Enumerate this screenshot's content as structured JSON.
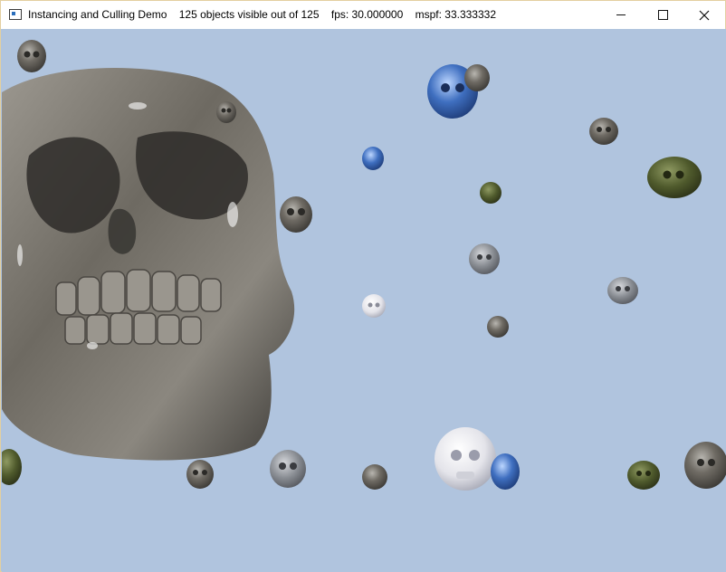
{
  "window": {
    "app": "Instancing and Culling Demo",
    "stats": "125 objects visible out of 125",
    "fps": "fps: 30.000000",
    "mspf": "mspf: 33.333332",
    "title_full": "Instancing and Culling Demo    125 objects visible out of 125    fps: 30.000000    mspf: 33.333332"
  },
  "scene": {
    "background_color": "#b0c4de",
    "objects": [
      {
        "name": "skull",
        "material": "stone",
        "color": "#6e6a62"
      },
      {
        "name": "skull",
        "material": "blue-glass",
        "color": "#3f6fc0"
      },
      {
        "name": "skull",
        "material": "white",
        "color": "#eeeef2"
      },
      {
        "name": "skull",
        "material": "green",
        "color": "#4f5a2c"
      },
      {
        "name": "skull",
        "material": "silver",
        "color": "#8a8e94"
      }
    ]
  }
}
